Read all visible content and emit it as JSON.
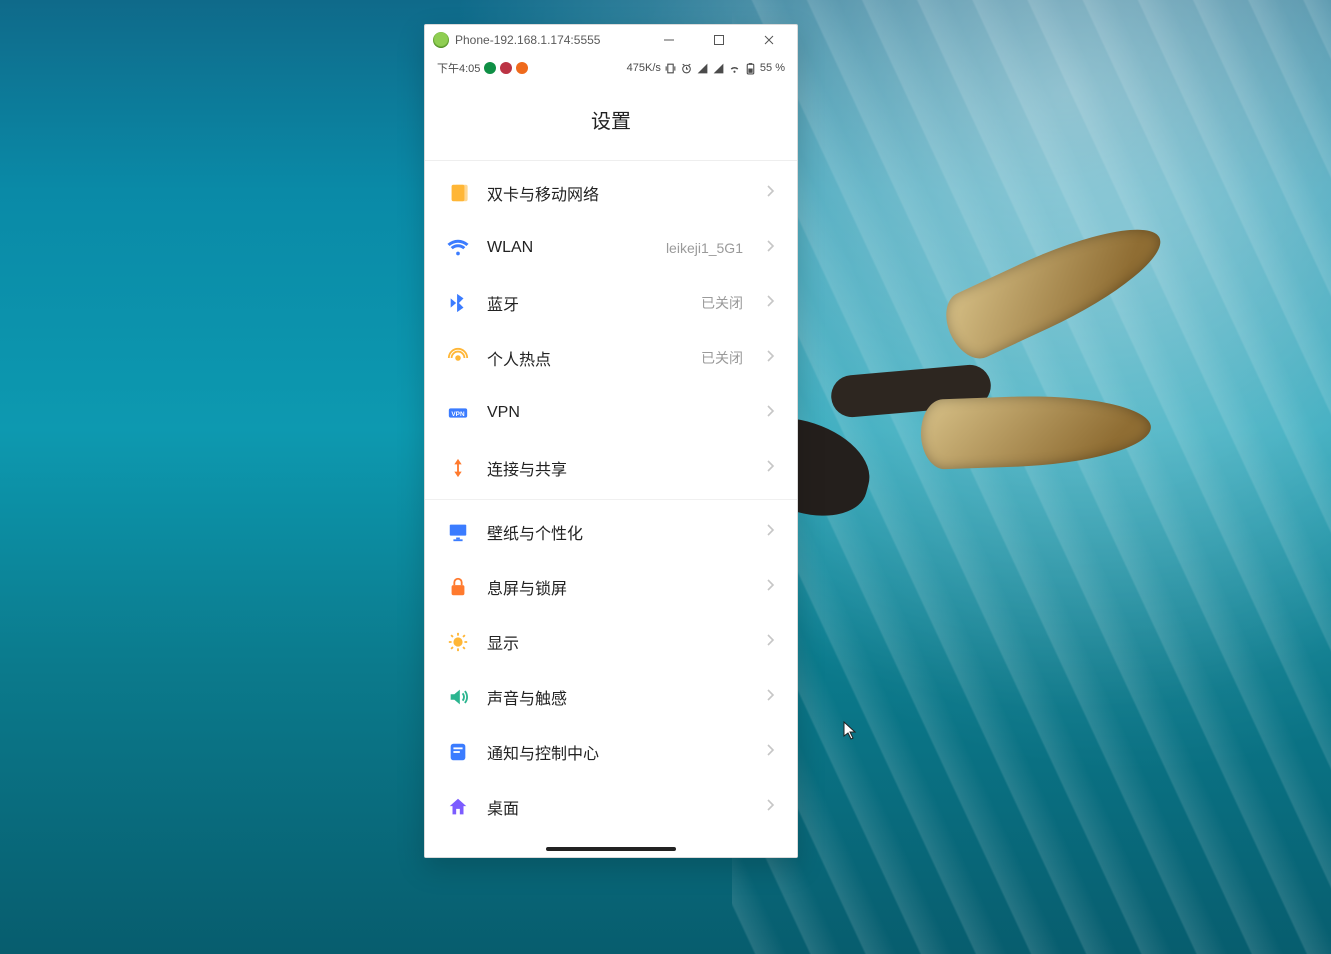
{
  "window": {
    "title": "Phone-192.168.1.174:5555"
  },
  "statusbar": {
    "time": "下午4:05",
    "net_speed": "475K/s",
    "battery": "55 %"
  },
  "page": {
    "title": "设置"
  },
  "sections": [
    {
      "rows": [
        {
          "icon": "sim-icon",
          "label": "双卡与移动网络",
          "value": ""
        },
        {
          "icon": "wifi-icon",
          "label": "WLAN",
          "value": "leikeji1_5G1"
        },
        {
          "icon": "bluetooth-icon",
          "label": "蓝牙",
          "value": "已关闭"
        },
        {
          "icon": "hotspot-icon",
          "label": "个人热点",
          "value": "已关闭"
        },
        {
          "icon": "vpn-icon",
          "label": "VPN",
          "value": ""
        },
        {
          "icon": "share-icon",
          "label": "连接与共享",
          "value": ""
        }
      ]
    },
    {
      "rows": [
        {
          "icon": "wallpaper-icon",
          "label": "壁纸与个性化",
          "value": ""
        },
        {
          "icon": "lock-icon",
          "label": "息屏与锁屏",
          "value": ""
        },
        {
          "icon": "display-icon",
          "label": "显示",
          "value": ""
        },
        {
          "icon": "sound-icon",
          "label": "声音与触感",
          "value": ""
        },
        {
          "icon": "notify-icon",
          "label": "通知与控制中心",
          "value": ""
        },
        {
          "icon": "home-icon",
          "label": "桌面",
          "value": ""
        }
      ]
    }
  ],
  "icon_colors": {
    "sim-icon": "#ffb636",
    "wifi-icon": "#3b7cff",
    "bluetooth-icon": "#3b7cff",
    "hotspot-icon": "#ffb636",
    "vpn-icon": "#3b7cff",
    "share-icon": "#ff7a2e",
    "wallpaper-icon": "#3b7cff",
    "lock-icon": "#ff7a2e",
    "display-icon": "#ffb636",
    "sound-icon": "#2bb58f",
    "notify-icon": "#3b7cff",
    "home-icon": "#7c5cff"
  }
}
